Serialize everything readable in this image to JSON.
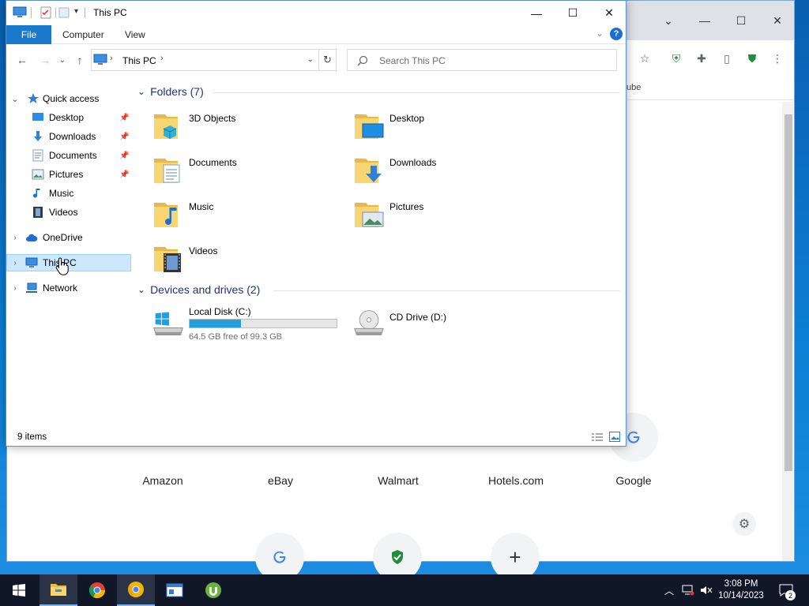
{
  "explorer": {
    "title": "This PC",
    "ribbon": {
      "file": "File",
      "tabs": [
        "Computer",
        "View"
      ]
    },
    "address": {
      "crumb": "This PC"
    },
    "search": {
      "placeholder": "Search This PC"
    },
    "nav": {
      "quick_access": "Quick access",
      "quick_items": [
        "Desktop",
        "Downloads",
        "Documents",
        "Pictures",
        "Music",
        "Videos"
      ],
      "onedrive": "OneDrive",
      "this_pc": "This PC",
      "network": "Network"
    },
    "folders_heading": "Folders (7)",
    "folders": [
      "3D Objects",
      "Desktop",
      "Documents",
      "Downloads",
      "Music",
      "Pictures",
      "Videos"
    ],
    "devices_heading": "Devices and drives (2)",
    "drives": [
      {
        "name": "Local Disk (C:)",
        "free": "64.5 GB free of 99.3 GB",
        "used_fraction": 0.35
      },
      {
        "name": "CD Drive (D:)"
      }
    ],
    "status": "9 items"
  },
  "chrome": {
    "bookmark_fragment": "ube",
    "shortcuts_row1": [
      "Amazon",
      "eBay",
      "Walmart",
      "Hotels.com",
      "Google"
    ]
  },
  "taskbar": {
    "time": "3:08 PM",
    "date": "10/14/2023",
    "notifications": "2"
  },
  "colors": {
    "accent": "#1979ca",
    "selection": "#cce8ff",
    "drive_fill": "#26a0da",
    "taskbar": "#101828"
  }
}
